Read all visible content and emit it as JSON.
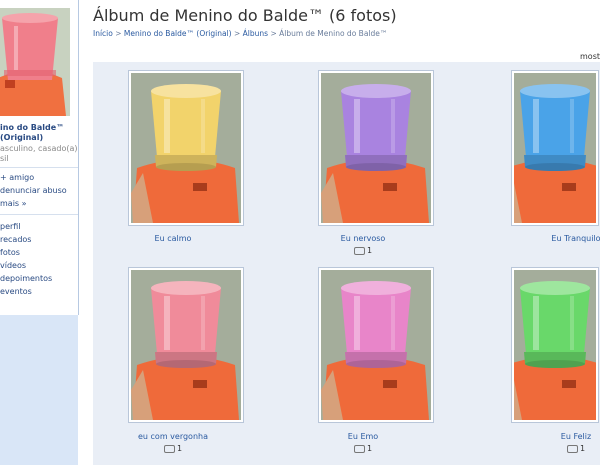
{
  "sidebar": {
    "name": "ino do Balde™ (Original)",
    "description_lines": [
      "asculino, casado(a)",
      "sil"
    ],
    "actions": [
      "+ amigo",
      "denunciar abuso",
      "mais »"
    ],
    "nav": [
      "perfil",
      "recados",
      "fotos",
      "vídeos",
      "depoimentos",
      "eventos"
    ]
  },
  "album": {
    "title": "Álbum de Menino do Balde™ (6 fotos)",
    "breadcrumb": [
      "Início",
      "Menino do Balde™ (Original)",
      "Álbuns",
      "Álbum de Menino do Balde™"
    ],
    "mostrar_label": "most",
    "photos": [
      {
        "caption": "Eu calmo",
        "comments": "",
        "bucket_color": "#f2d36b"
      },
      {
        "caption": "Eu nervoso",
        "comments": "1",
        "bucket_color": "#a983e0"
      },
      {
        "caption": "Eu Tranquilo",
        "comments": "",
        "bucket_color": "#4aa3e8"
      },
      {
        "caption": "eu com vergonha",
        "comments": "1",
        "bucket_color": "#f08b9a"
      },
      {
        "caption": "Eu Emo",
        "comments": "1",
        "bucket_color": "#e885c9"
      },
      {
        "caption": "Eu Feliz",
        "comments": "1",
        "bucket_color": "#69d86a"
      }
    ]
  },
  "profile_bucket_color": "#f07f8b"
}
